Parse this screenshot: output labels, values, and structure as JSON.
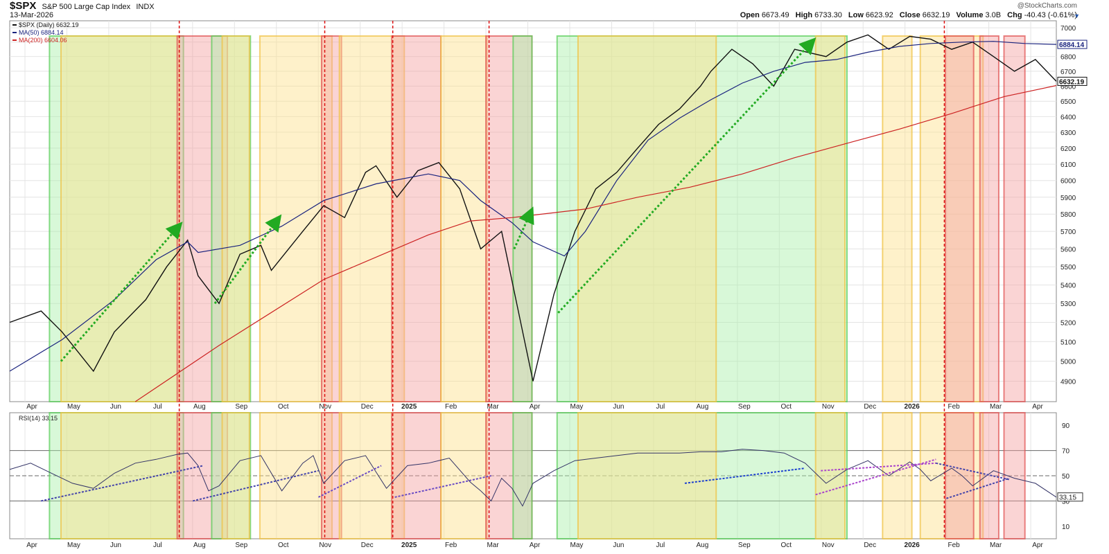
{
  "header": {
    "symbol": "$SPX",
    "name": "S&P 500 Large Cap Index",
    "exchange": "INDX",
    "date": "13-Mar-2026",
    "credit": "@StockCharts.com",
    "quote": {
      "open_label": "Open",
      "open": "6673.49",
      "high_label": "High",
      "high": "6733.30",
      "low_label": "Low",
      "low": "6623.92",
      "close_label": "Close",
      "close": "6632.19",
      "volume_label": "Volume",
      "volume": "3.0B",
      "chg_label": "Chg",
      "chg": "-40.43 (-0.61%)"
    }
  },
  "chart_data": [
    {
      "type": "line",
      "panel": "price",
      "legend": [
        {
          "text": "$SPX (Daily) 6632.19",
          "color": "#111111"
        },
        {
          "text": "MA(50) 6884.14",
          "color": "#1a237e"
        },
        {
          "text": "MA(200) 6604.06",
          "color": "#cc2222"
        }
      ],
      "scale": "log",
      "ylim": [
        4800,
        7050
      ],
      "y_ticks": [
        4900,
        5000,
        5100,
        5200,
        5300,
        5400,
        5500,
        5600,
        5700,
        5800,
        5900,
        6000,
        6100,
        6200,
        6300,
        6400,
        6500,
        6600,
        6700,
        6800,
        6900,
        7000
      ],
      "x_ticks": [
        "Apr",
        "May",
        "Jun",
        "Jul",
        "Aug",
        "Sep",
        "Oct",
        "Nov",
        "Dec",
        "2025",
        "Feb",
        "Mar",
        "Apr",
        "May",
        "Jun",
        "Jul",
        "Aug",
        "Sep",
        "Oct",
        "Nov",
        "Dec",
        "2026",
        "Feb",
        "Mar",
        "Apr"
      ],
      "price_labels": [
        {
          "text": "6884.14",
          "value": 6884,
          "color": "#1a237e",
          "bg": "#ffffff"
        },
        {
          "text": "6632.19",
          "value": 6632,
          "color": "#111111",
          "bg": "#ffffff"
        }
      ],
      "series": [
        {
          "name": "$SPX",
          "color": "#111111",
          "x": [
            0,
            3,
            5,
            8,
            10,
            13,
            15,
            17,
            18,
            20,
            22,
            24,
            25,
            28,
            30,
            32,
            34,
            35,
            37,
            39,
            41,
            43,
            45,
            47,
            50,
            52,
            54,
            56,
            58,
            60,
            62,
            64,
            66,
            67,
            69,
            71,
            73,
            75,
            78,
            80,
            82,
            84,
            86,
            88,
            90,
            92,
            94,
            96,
            98,
            100
          ],
          "values": [
            5200,
            5260,
            5150,
            4950,
            5150,
            5320,
            5500,
            5650,
            5450,
            5300,
            5570,
            5620,
            5480,
            5700,
            5850,
            5780,
            6050,
            6090,
            5900,
            6060,
            6110,
            5950,
            5600,
            5700,
            4900,
            5350,
            5700,
            5950,
            6050,
            6200,
            6350,
            6450,
            6600,
            6700,
            6850,
            6750,
            6600,
            6850,
            6800,
            6900,
            6950,
            6850,
            6940,
            6920,
            6850,
            6900,
            6800,
            6700,
            6780,
            6632
          ]
        },
        {
          "name": "MA(50)",
          "color": "#1a237e",
          "x": [
            0,
            5,
            10,
            14,
            17,
            18,
            22,
            26,
            30,
            35,
            40,
            43,
            45,
            48,
            50,
            53,
            55,
            58,
            61,
            64,
            67,
            70,
            73,
            76,
            79,
            82,
            85,
            88,
            91,
            94,
            97,
            100
          ],
          "values": [
            4950,
            5110,
            5320,
            5540,
            5640,
            5580,
            5620,
            5730,
            5880,
            5980,
            6040,
            6000,
            5880,
            5750,
            5640,
            5560,
            5700,
            6000,
            6250,
            6390,
            6510,
            6620,
            6700,
            6760,
            6780,
            6830,
            6870,
            6890,
            6900,
            6905,
            6890,
            6884
          ]
        },
        {
          "name": "MA(200)",
          "color": "#cc2222",
          "x": [
            12,
            20,
            30,
            40,
            44,
            48,
            55,
            60,
            65,
            70,
            75,
            80,
            85,
            90,
            95,
            100
          ],
          "values": [
            4800,
            5080,
            5430,
            5680,
            5760,
            5780,
            5830,
            5900,
            5960,
            6040,
            6140,
            6230,
            6320,
            6420,
            6530,
            6604
          ]
        }
      ]
    },
    {
      "type": "line",
      "panel": "indicator",
      "legend": [
        {
          "text": "RSI(14) 33.15",
          "color": "#111111"
        }
      ],
      "ylim": [
        0,
        100
      ],
      "y_ticks": [
        10,
        30,
        50,
        70,
        90
      ],
      "reference_lines": [
        30,
        50,
        70
      ],
      "value_label": {
        "text": "33.15",
        "value": 33.15
      },
      "series": [
        {
          "name": "RSI(14)",
          "color": "#333366",
          "x": [
            0,
            2,
            4,
            6,
            8,
            10,
            12,
            14,
            16,
            17,
            18,
            19,
            20,
            22,
            24,
            26,
            28,
            29,
            30,
            32,
            34,
            36,
            38,
            40,
            42,
            44,
            45,
            46,
            47,
            48,
            49,
            50,
            52,
            54,
            56,
            58,
            60,
            62,
            64,
            66,
            68,
            70,
            72,
            74,
            76,
            78,
            80,
            82,
            84,
            86,
            87,
            88,
            90,
            91,
            92,
            94,
            96,
            98,
            100
          ],
          "values": [
            55,
            60,
            52,
            44,
            40,
            52,
            60,
            63,
            67,
            68,
            58,
            38,
            42,
            62,
            66,
            38,
            60,
            66,
            44,
            62,
            66,
            40,
            58,
            60,
            64,
            45,
            38,
            30,
            48,
            40,
            26,
            44,
            54,
            62,
            64,
            66,
            68,
            68,
            68,
            69,
            69,
            71,
            70,
            68,
            60,
            44,
            55,
            62,
            50,
            61,
            55,
            46,
            56,
            50,
            42,
            54,
            48,
            44,
            33
          ]
        }
      ]
    }
  ],
  "annotations": {
    "zones": [
      {
        "color": "green",
        "from": 3.8,
        "to": 16.6,
        "panel": "both"
      },
      {
        "color": "yellow",
        "from": 4.9,
        "to": 16.2,
        "panel": "both"
      },
      {
        "color": "red",
        "from": 16.0,
        "to": 20.8,
        "panel": "both"
      },
      {
        "color": "green",
        "from": 19.3,
        "to": 23.0,
        "panel": "both"
      },
      {
        "color": "yellow",
        "from": 20.3,
        "to": 22.9,
        "panel": "both"
      },
      {
        "color": "yellow",
        "from": 23.9,
        "to": 30.8,
        "panel": "both"
      },
      {
        "color": "red",
        "from": 29.8,
        "to": 31.7,
        "panel": "both"
      },
      {
        "color": "yellow",
        "from": 31.5,
        "to": 37.7,
        "panel": "both"
      },
      {
        "color": "red",
        "from": 36.5,
        "to": 41.2,
        "panel": "both"
      },
      {
        "color": "yellow",
        "from": 41.2,
        "to": 45.6,
        "panel": "both"
      },
      {
        "color": "red",
        "from": 45.5,
        "to": 49.9,
        "panel": "both"
      },
      {
        "color": "green",
        "from": 48.1,
        "to": 49.9,
        "panel": "both"
      },
      {
        "color": "green",
        "from": 52.3,
        "to": 80.0,
        "panel": "both"
      },
      {
        "color": "yellow",
        "from": 54.3,
        "to": 67.5,
        "panel": "both"
      },
      {
        "color": "yellow",
        "from": 77.0,
        "to": 79.8,
        "panel": "both"
      },
      {
        "color": "yellow",
        "from": 83.4,
        "to": 86.2,
        "panel": "both"
      },
      {
        "color": "yellow",
        "from": 87.0,
        "to": 93.0,
        "panel": "both"
      },
      {
        "color": "red",
        "from": 89.4,
        "to": 92.1,
        "panel": "both"
      },
      {
        "color": "red",
        "from": 92.7,
        "to": 94.5,
        "panel": "both"
      },
      {
        "color": "red",
        "from": 95.0,
        "to": 97.0,
        "panel": "both"
      }
    ],
    "vertical_markers": [
      16.2,
      30.1,
      36.6,
      45.8,
      89.3
    ],
    "trend_arrows": [
      {
        "x": [
          4.9,
          16.0
        ],
        "y": [
          5000,
          5720
        ]
      },
      {
        "x": [
          19.6,
          25.5
        ],
        "y": [
          5300,
          5760
        ]
      },
      {
        "x": [
          48.2,
          49.7
        ],
        "y": [
          5600,
          5800
        ]
      },
      {
        "x": [
          52.4,
          76.5
        ],
        "y": [
          5250,
          6890
        ]
      }
    ],
    "rsi_trendlines": [
      {
        "x": [
          3,
          18.5
        ],
        "y": [
          30,
          58
        ],
        "color": "#4444aa"
      },
      {
        "x": [
          17.5,
          29.5
        ],
        "y": [
          30,
          54
        ],
        "color": "#4444aa"
      },
      {
        "x": [
          29.5,
          35.5
        ],
        "y": [
          33,
          58
        ],
        "color": "#6a4bc4"
      },
      {
        "x": [
          36.8,
          46
        ],
        "y": [
          33,
          50
        ],
        "color": "#6a4bc4"
      },
      {
        "x": [
          64.5,
          76
        ],
        "y": [
          44,
          56
        ],
        "color": "#1a3ecf"
      },
      {
        "x": [
          77,
          88.5
        ],
        "y": [
          35,
          63
        ],
        "color": "#aa44cc"
      },
      {
        "x": [
          77.5,
          88.5
        ],
        "y": [
          54,
          60
        ],
        "color": "#aa44cc"
      },
      {
        "x": [
          89.5,
          95.5
        ],
        "y": [
          32,
          48
        ],
        "color": "#4444aa"
      },
      {
        "x": [
          88.5,
          95.5
        ],
        "y": [
          60,
          47
        ],
        "color": "#4444aa"
      }
    ]
  }
}
